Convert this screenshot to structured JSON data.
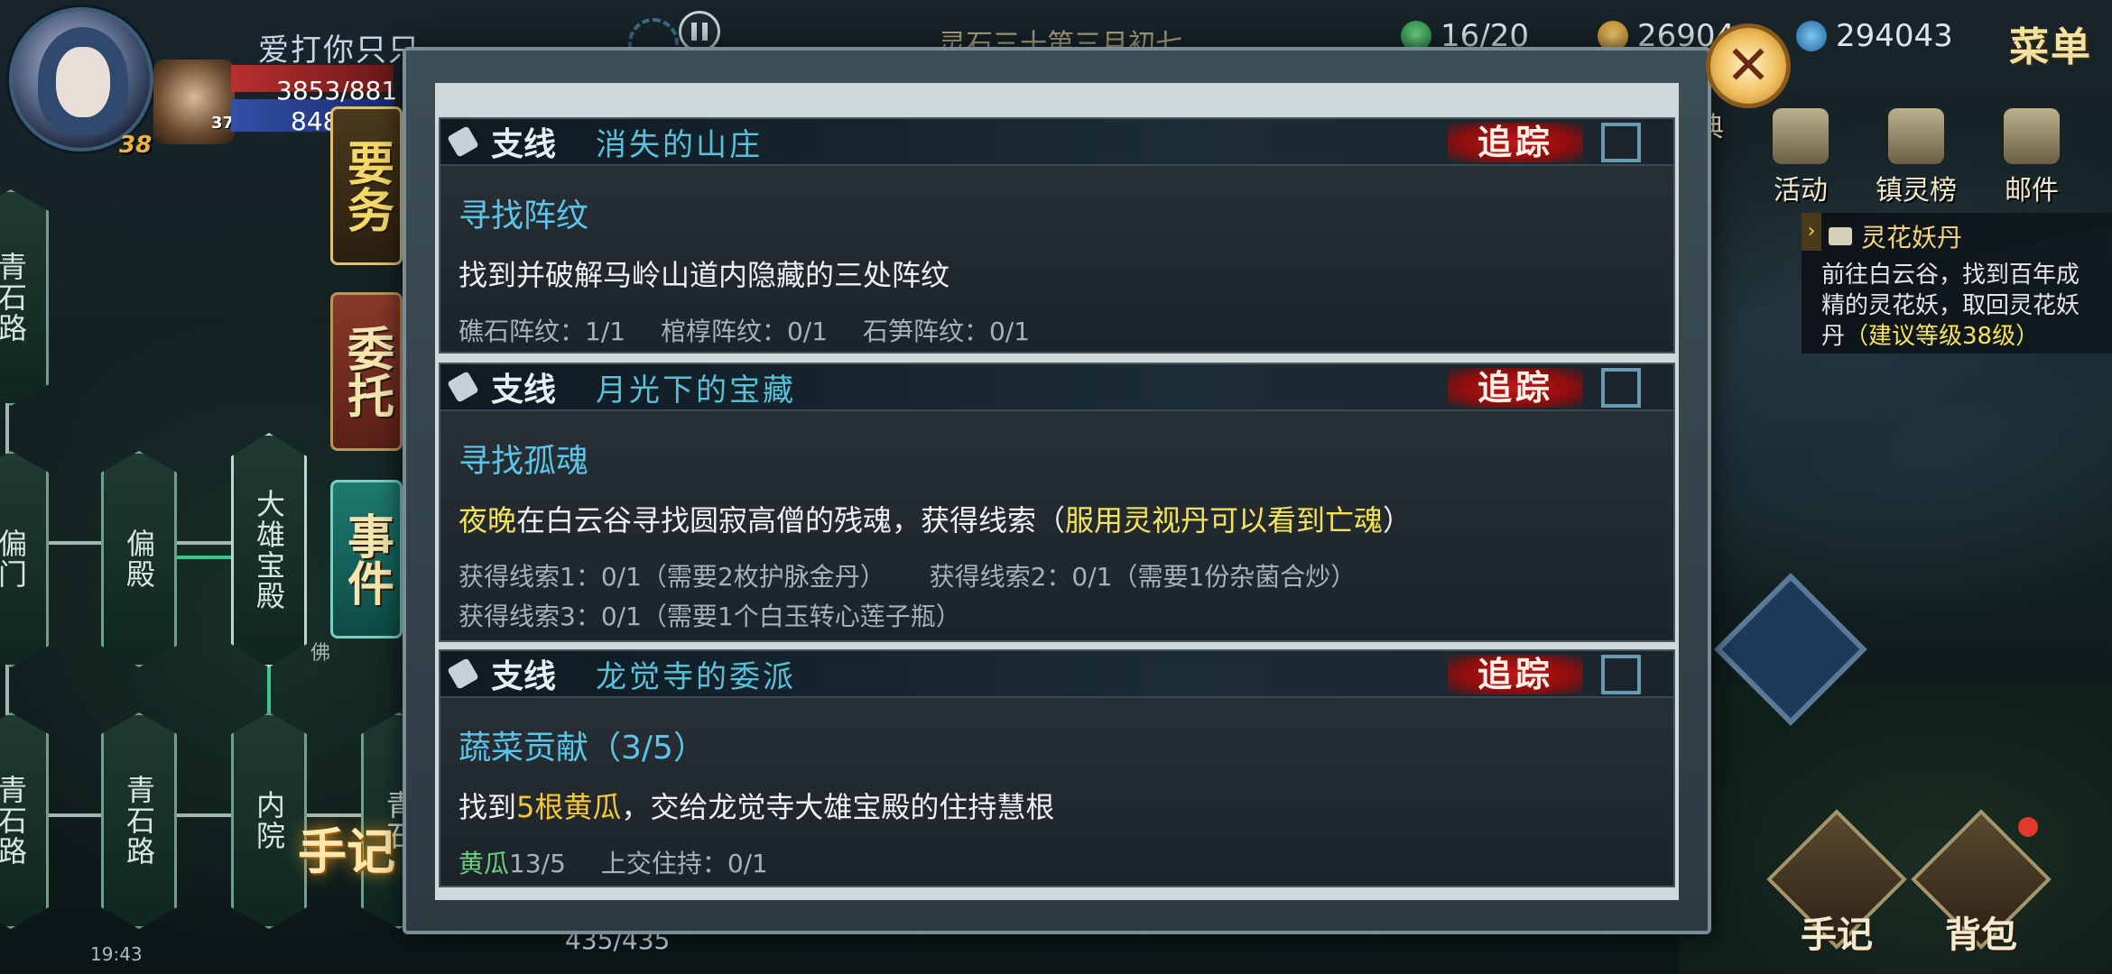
{
  "player": {
    "name": "爱打你只只",
    "level": "38",
    "companion_level": "37",
    "hp": "3853/881",
    "mp": "848"
  },
  "hud": {
    "title": "灵石三十第三月初七",
    "stamina": "16/20",
    "gold": "26904",
    "jade": "294043",
    "menu_label": "菜单"
  },
  "side_icons": {
    "partial_label": "典",
    "events_label": "活动",
    "town_label": "镇灵榜",
    "mail_label": "邮件"
  },
  "tracker": {
    "title": "灵花妖丹",
    "desc_lines": [
      "前往白云谷，找到百年成",
      "精的灵花妖，取回灵花妖",
      "丹"
    ],
    "recommend": "（建议等级38级）"
  },
  "tabs": {
    "main": "要务",
    "entrust": "委托",
    "events": "事件"
  },
  "map": {
    "nodes": [
      "青石路",
      "偏门",
      "偏殿",
      "大雄宝殿",
      "青石路",
      "青石路",
      "内院",
      "青石"
    ],
    "side_note": "佛"
  },
  "journal_label": "手记",
  "status_time": "19:43",
  "bottom_hp": "435/435",
  "bottom_buttons": {
    "journal": "手记",
    "bag": "背包"
  },
  "close_label": "✕",
  "quests": [
    {
      "type": "支线",
      "name": "消失的山庄",
      "track_label": "追踪",
      "step": "寻找阵纹",
      "desc": "找到并破解马岭山道内隐藏的三处阵纹",
      "progress_line1": [
        "礁石阵纹：1/1",
        "棺椁阵纹：0/1",
        "石笋阵纹：0/1"
      ]
    },
    {
      "type": "支线",
      "name": "月光下的宝藏",
      "track_label": "追踪",
      "step": "寻找孤魂",
      "desc_highlight": "夜晚",
      "desc_main": "在白云谷寻找圆寂高僧的残魂，获得线索（",
      "desc_hint": "服用灵视丹可以看到亡魂",
      "desc_close": "）",
      "progress_line1": [
        "获得线索1：0/1（需要2枚护脉金丹）",
        "获得线索2：0/1（需要1份杂菌合炒）"
      ],
      "progress_line2": "获得线索3：0/1（需要1个白玉转心莲子瓶）"
    },
    {
      "type": "支线",
      "name": "龙觉寺的委派",
      "track_label": "追踪",
      "step": "蔬菜贡献（3/5）",
      "desc_pre": "找到",
      "desc_highlight": "5根黄瓜",
      "desc_post": "，交给龙觉寺大雄宝殿的住持慧根",
      "progress_green": "黄瓜",
      "progress_count": "13/5",
      "progress_rest": "上交住持：0/1"
    }
  ]
}
